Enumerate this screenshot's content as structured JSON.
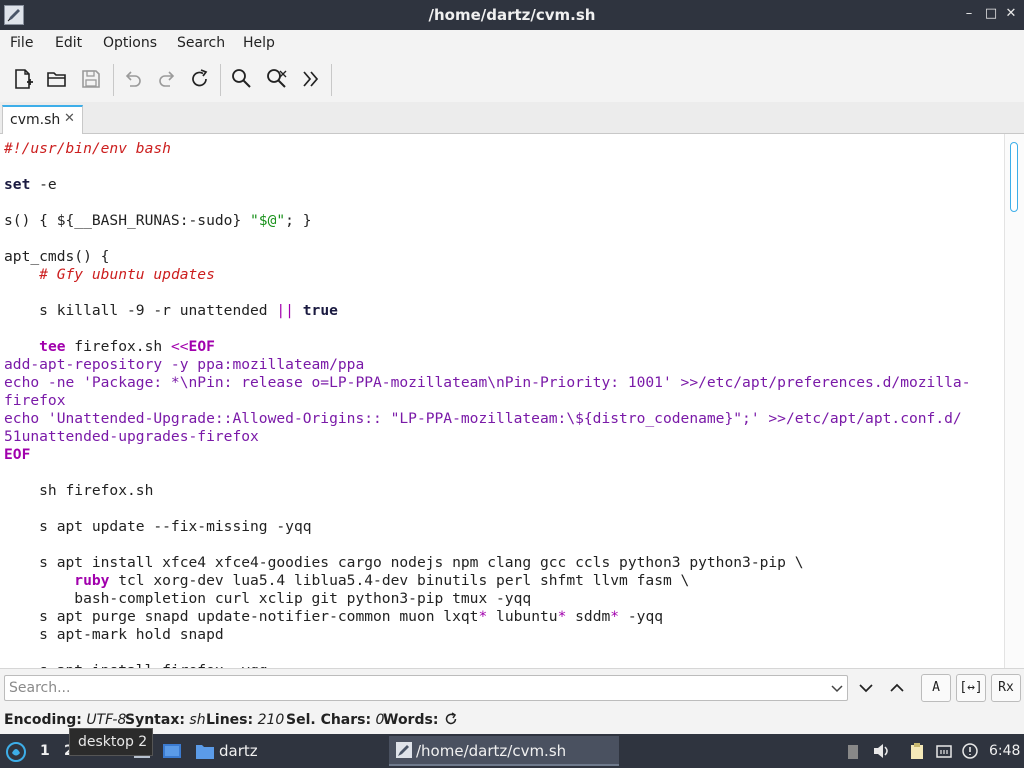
{
  "window": {
    "title": "/home/dartz/cvm.sh",
    "minimize_glyph": "–",
    "maximize_glyph": "□",
    "close_glyph": "✕"
  },
  "menubar": {
    "items": [
      "File",
      "Edit",
      "Options",
      "Search",
      "Help"
    ]
  },
  "toolbar": {
    "icons": [
      "new-file-icon",
      "open-folder-icon",
      "save-icon",
      "undo-icon",
      "redo-icon",
      "reload-icon",
      "find-icon",
      "find-replace-icon",
      "more-icon"
    ]
  },
  "tabs": [
    {
      "label": "cvm.sh",
      "close_glyph": "✕",
      "active": true
    }
  ],
  "editor": {
    "language": "sh",
    "lines": [
      [
        {
          "t": "#!/usr/bin/env bash",
          "c": "comment"
        }
      ],
      [],
      [
        {
          "t": "set",
          "c": "keyword"
        },
        {
          "t": " -e",
          "c": "plain"
        }
      ],
      [],
      [
        {
          "t": "s() { ${__BASH_RUNAS:-sudo} ",
          "c": "plain"
        },
        {
          "t": "\"$@\"",
          "c": "string"
        },
        {
          "t": "; }",
          "c": "plain"
        }
      ],
      [],
      [
        {
          "t": "apt_cmds() {",
          "c": "plain"
        }
      ],
      [
        {
          "t": "    ",
          "c": "plain"
        },
        {
          "t": "# Gfy ubuntu updates",
          "c": "comment"
        }
      ],
      [],
      [
        {
          "t": "    s killall -9 -r unattended ",
          "c": "plain"
        },
        {
          "t": "||",
          "c": "op"
        },
        {
          "t": " ",
          "c": "plain"
        },
        {
          "t": "true",
          "c": "keyword"
        }
      ],
      [],
      [
        {
          "t": "    ",
          "c": "plain"
        },
        {
          "t": "tee",
          "c": "builtin"
        },
        {
          "t": " firefox.sh ",
          "c": "plain"
        },
        {
          "t": "<<",
          "c": "op"
        },
        {
          "t": "EOF",
          "c": "builtin"
        }
      ],
      [
        {
          "t": "add-apt-repository -y ppa:mozillateam/ppa",
          "c": "heredoc"
        }
      ],
      [
        {
          "t": "echo -ne 'Package: *\\nPin: release o=LP-PPA-mozillateam\\nPin-Priority: 1001' >>/etc/apt/preferences.d/mozilla-",
          "c": "heredoc"
        }
      ],
      [
        {
          "t": "firefox",
          "c": "heredoc"
        }
      ],
      [
        {
          "t": "echo 'Unattended-Upgrade::Allowed-Origins:: \"LP-PPA-mozillateam:\\${distro_codename}\";' >>/etc/apt/apt.conf.d/",
          "c": "heredoc"
        }
      ],
      [
        {
          "t": "51unattended-upgrades-firefox",
          "c": "heredoc"
        }
      ],
      [
        {
          "t": "EOF",
          "c": "builtin"
        }
      ],
      [],
      [
        {
          "t": "    sh firefox.sh",
          "c": "plain"
        }
      ],
      [],
      [
        {
          "t": "    s apt update --fix-missing -yqq",
          "c": "plain"
        }
      ],
      [],
      [
        {
          "t": "    s apt install xfce4 xfce4-goodies cargo nodejs npm clang gcc ccls python3 python3-pip \\",
          "c": "plain"
        }
      ],
      [
        {
          "t": "        ",
          "c": "plain"
        },
        {
          "t": "ruby",
          "c": "builtin"
        },
        {
          "t": " tcl xorg-dev lua5.4 liblua5.4-dev binutils perl shfmt llvm fasm \\",
          "c": "plain"
        }
      ],
      [
        {
          "t": "        bash-completion curl xclip git python3-pip tmux -yqq",
          "c": "plain"
        }
      ],
      [
        {
          "t": "    s apt purge snapd update-notifier-common muon lxqt",
          "c": "plain"
        },
        {
          "t": "*",
          "c": "op"
        },
        {
          "t": " lubuntu",
          "c": "plain"
        },
        {
          "t": "*",
          "c": "op"
        },
        {
          "t": " sddm",
          "c": "plain"
        },
        {
          "t": "*",
          "c": "op"
        },
        {
          "t": " -yqq",
          "c": "plain"
        }
      ],
      [
        {
          "t": "    s apt-mark hold snapd",
          "c": "plain"
        }
      ],
      [],
      [
        {
          "t": "    s apt install firefox -yqq",
          "c": "plain"
        }
      ]
    ],
    "scroll_fraction": 0.0
  },
  "search": {
    "placeholder": "Search...",
    "value": "",
    "match_case_label": "A",
    "whole_word_label": "[↔]",
    "regex_label": "Rx"
  },
  "status": {
    "encoding_label": "Encoding:",
    "encoding_value": "UTF-8",
    "syntax_label": "Syntax:",
    "syntax_value": "sh",
    "lines_label": "Lines:",
    "lines_value": "210",
    "selchars_label": "Sel. Chars:",
    "selchars_value": "0",
    "words_label": "Words:"
  },
  "taskbar": {
    "desktop_1": "1",
    "desktop_2": "2",
    "tooltip": "desktop 2",
    "folder_label": "dartz",
    "active_task_label": "/home/dartz/cvm.sh",
    "clock": "6:48"
  },
  "colors": {
    "titlebar_bg": "#2f343f",
    "accent": "#3daee9",
    "comment": "#cc1f1f",
    "builtin": "#a100ad",
    "heredoc": "#7a1aa8",
    "string": "#18911a"
  }
}
